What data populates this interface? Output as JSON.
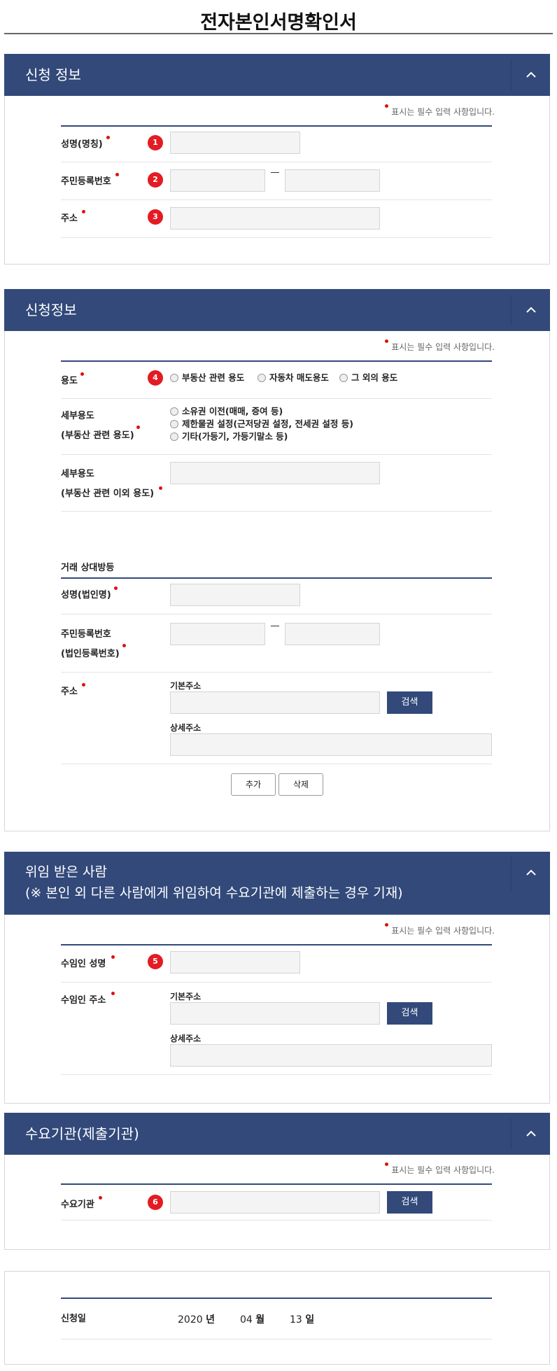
{
  "doc_title": "전자본인서명확인서",
  "required_note": "표시는 필수 입력 사항입니다.",
  "icons": {
    "collapse": "chevron-up-icon",
    "required": "red-dot"
  },
  "colors": {
    "header_bg": "#32497a",
    "step_badge": "#e31b23",
    "required_dot": "#dd1111"
  },
  "applicant": {
    "header": "신청 정보",
    "name_label": "성명(명칭)",
    "rrn_label": "주민등록번호",
    "address_label": "주소",
    "steps": [
      "1",
      "2",
      "3"
    ]
  },
  "application": {
    "header": "신청정보",
    "purpose_label": "용도",
    "purpose_step": "4",
    "purpose_options": [
      "부동산 관련 용도",
      "자동차 매도용도",
      "그 외의 용도"
    ],
    "detail_label_1": "세부용도",
    "detail_label_2": "(부동산 관련 용도)",
    "detail_options": [
      "소유권 이전(매매, 증여 등)",
      "제한물권 설정(근저당권 설정, 전세권 설정 등)",
      "기타(가등기, 가등기말소 등)"
    ],
    "detail_other_label_1": "세부용도",
    "detail_other_label_2": "(부동산 관련 이외 용도)",
    "counterparty_title": "거래 상대방등",
    "cp_name_label": "성명(법인명)",
    "cp_rrn_label_1": "주민등록번호",
    "cp_rrn_label_2": "(법인등록번호)",
    "cp_address_label": "주소",
    "basic_address": "기본주소",
    "detail_address": "상세주소",
    "search_button": "검색",
    "add_button": "추가",
    "delete_button": "삭제"
  },
  "delegate": {
    "header_line1": "위임 받은 사람",
    "header_line2": "(※ 본인 외 다른 사람에게 위임하여 수요기관에 제출하는 경우 기재)",
    "name_label": "수임인 성명",
    "name_step": "5",
    "address_label": "수임인 주소",
    "basic_address": "기본주소",
    "detail_address": "상세주소",
    "search_button": "검색"
  },
  "agency": {
    "header": "수요기관(제출기관)",
    "label": "수요기관",
    "step": "6",
    "search_button": "검색"
  },
  "date": {
    "label": "신청일",
    "year": "2020",
    "year_unit": "년",
    "month": "04",
    "month_unit": "월",
    "day": "13",
    "day_unit": "일"
  }
}
